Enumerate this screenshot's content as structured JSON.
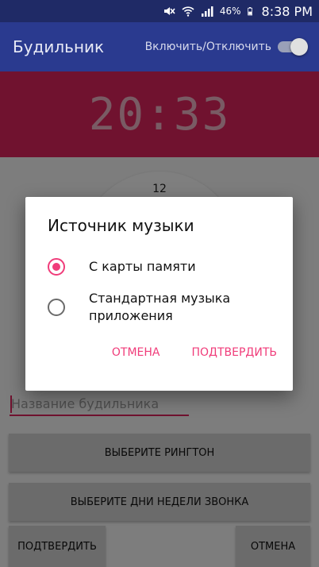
{
  "status_bar": {
    "battery_percent": "46%",
    "time": "8:38 PM",
    "icons": [
      "mute-icon",
      "wifi-icon",
      "signal-icon",
      "battery-icon"
    ]
  },
  "app_bar": {
    "title": "Будильник",
    "toggle_label": "Включить/Отключить",
    "toggle_on": false
  },
  "clock": {
    "digital_time": "20:33",
    "analog_top_numeral": "12"
  },
  "form": {
    "name_placeholder": "Название будильника",
    "name_value": "",
    "ringtone_button": "Выберите рингтон",
    "days_button": "Выберите дни недели звонка",
    "confirm_button": "Подтвердить",
    "cancel_button": "Отмена"
  },
  "dialog": {
    "title": "Источник музыки",
    "options": [
      {
        "label": "С карты памяти",
        "selected": true
      },
      {
        "label": "Стандартная музыка приложения",
        "selected": false
      }
    ],
    "cancel": "Отмена",
    "confirm": "Подтвердить"
  },
  "colors": {
    "app_bar": "#2a3a8f",
    "clock_header": "#e0245e",
    "accent": "#f03c7a"
  }
}
